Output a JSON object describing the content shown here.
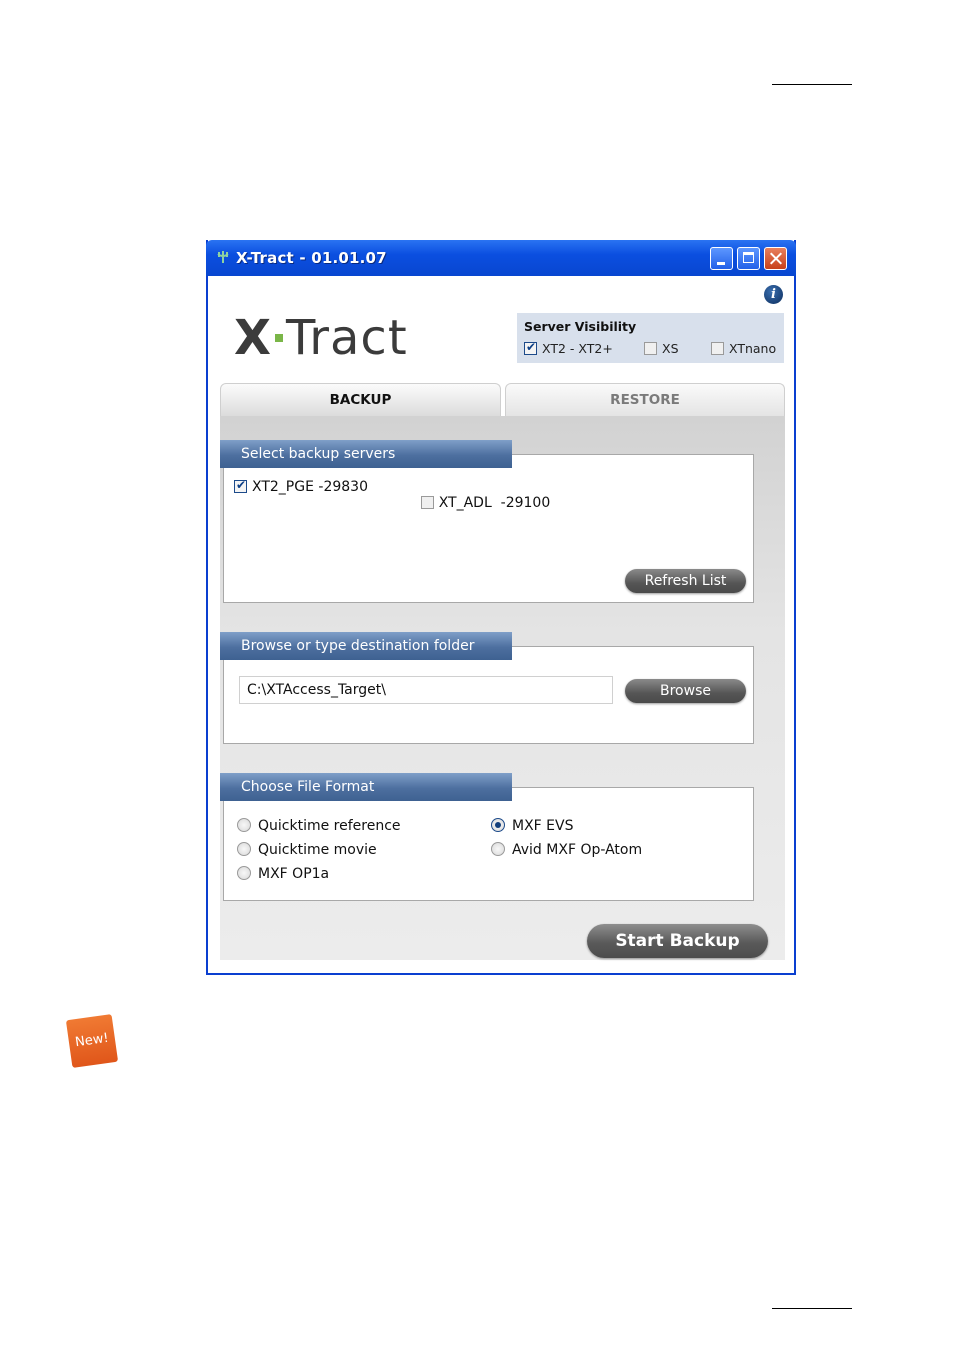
{
  "window": {
    "title": "X-Tract - 01.01.07"
  },
  "logo": {
    "text": "X·Tract"
  },
  "server_visibility": {
    "title": "Server Visibility",
    "options": [
      {
        "label": "XT2 - XT2+",
        "checked": true
      },
      {
        "label": "XS",
        "checked": false
      },
      {
        "label": "XTnano",
        "checked": false
      }
    ]
  },
  "tabs": [
    {
      "label": "BACKUP",
      "active": true
    },
    {
      "label": "RESTORE",
      "active": false
    }
  ],
  "servers_section": {
    "header": "Select backup servers",
    "servers": [
      {
        "label": "XT2_PGE -29830",
        "checked": true
      },
      {
        "label": "XT_ADL  -29100",
        "checked": false
      }
    ],
    "refresh_label": "Refresh List"
  },
  "destination_section": {
    "header": "Browse or type destination folder",
    "path_value": "C:\\XTAccess_Target\\",
    "browse_label": "Browse"
  },
  "format_section": {
    "header": "Choose File Format",
    "options": [
      {
        "label": "Quicktime reference",
        "selected": false
      },
      {
        "label": "Quicktime movie",
        "selected": false
      },
      {
        "label": "MXF OP1a",
        "selected": false
      },
      {
        "label": "MXF EVS",
        "selected": true
      },
      {
        "label": "Avid MXF Op-Atom",
        "selected": false
      }
    ]
  },
  "start_label": "Start Backup",
  "new_badge": "New!",
  "colors": {
    "titlebar": "#0b4fe0",
    "panel_header": "#4d6f9f",
    "badge": "#e8661f"
  }
}
